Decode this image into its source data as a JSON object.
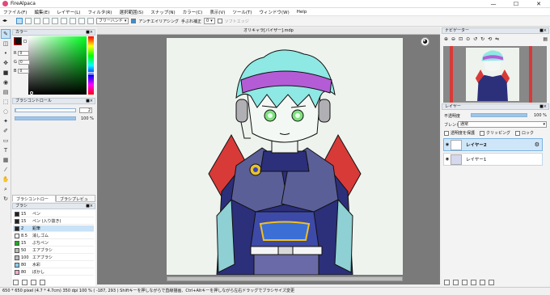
{
  "window": {
    "title": "FireAlpaca",
    "controls": [
      "—",
      "☐",
      "✕"
    ]
  },
  "menu": [
    "ファイル(F)",
    "編集(E)",
    "レイヤー(L)",
    "フィルタ(R)",
    "選択範囲(S)",
    "スナップ(N)",
    "カラー(C)",
    "表示(V)",
    "ツール(T)",
    "ウィンドウ(W)",
    "Help"
  ],
  "toolbar": {
    "brush_mode": "フリーハンド",
    "antialias_label": "アンチエイリアシング",
    "stabilizer_label": "手ぶれ補正",
    "stabilizer_value": "0",
    "soft_edge_label": "ソフトエッジ"
  },
  "color_panel": {
    "title": "カラー",
    "r_label": "R",
    "r_value": "0",
    "g_label": "G",
    "g_value": "0",
    "b_label": "B",
    "b_value": "0",
    "foreground_color": "#111111"
  },
  "brush_control": {
    "title": "ブラシコントロール",
    "size_value": "2",
    "opacity_value": "100 %",
    "opacity_fraction": 1.0
  },
  "tabs": [
    "ブラシコントロール",
    "ブラシプレビュー"
  ],
  "brush_panel": {
    "title": "ブラシ",
    "items": [
      {
        "size": "15",
        "name": "ペン",
        "color": "#222222"
      },
      {
        "size": "15",
        "name": "ペン (入り抜き)",
        "color": "#222222"
      },
      {
        "size": "2",
        "name": "鉛筆",
        "color": "#222222",
        "selected": true
      },
      {
        "size": "8.5",
        "name": "消しゴム",
        "color": "#ffffff"
      },
      {
        "size": "15",
        "name": "ぶちペン",
        "color": "#22aa22"
      },
      {
        "size": "50",
        "name": "エアブラシ",
        "color": "#bbbbbb"
      },
      {
        "size": "100",
        "name": "エアブラシ",
        "color": "#bbbbbb"
      },
      {
        "size": "80",
        "name": "水彩",
        "color": "#88ccee"
      },
      {
        "size": "80",
        "name": "ぼかし",
        "color": "#ffaacc"
      }
    ]
  },
  "document": {
    "tab_title": "オリキャラ[バイザー].mdp"
  },
  "navigator": {
    "title": "ナビゲーター"
  },
  "layer_panel": {
    "title": "レイヤー",
    "opacity_label": "不透明度",
    "opacity_value": "100 %",
    "blend_label": "ブレンド",
    "blend_value": "通常",
    "protect_label": "透明度を保護",
    "clipping_label": "クリッピング",
    "lock_label": "ロック",
    "layers": [
      {
        "name": "レイヤー2",
        "selected": true
      },
      {
        "name": "レイヤー1",
        "selected": false
      }
    ]
  },
  "status": {
    "text": "650 * 650 pixel  (4.7 * 4.7cm)  350 dpi  100 %  ( -187, 293 )  Shiftキーを押しながらで直線描画、Ctrl+Altキーを押しながら左右ドラッグでブラシサイズ変更"
  }
}
